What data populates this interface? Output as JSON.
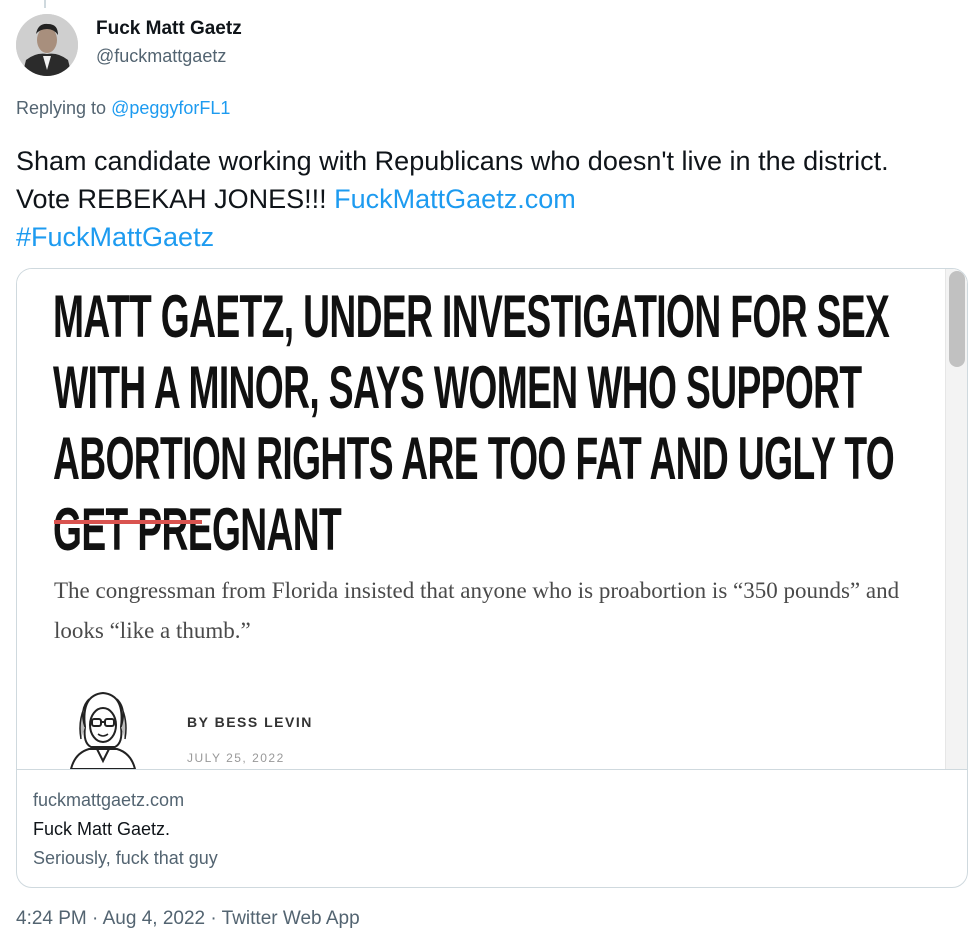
{
  "author": {
    "display_name": "Fuck Matt Gaetz",
    "handle": "@fuckmattgaetz"
  },
  "reply": {
    "prefix": "Replying to",
    "target": "@peggyforFL1"
  },
  "tweet": {
    "text_main": "Sham candidate working with Republicans who doesn't live in the district. Vote REBEKAH JONES!!!",
    "link": "FuckMattGaetz.com",
    "hashtag": "#FuckMattGaetz"
  },
  "card": {
    "image": {
      "headline": "Matt Gaetz, under investigation for sex with a minor, says women who support abortion rights are too fat and ugly to get pregnant",
      "dek": "The congressman from Florida insisted that anyone who is proabortion is “350 pounds” and looks “like a thumb.”",
      "byline": "BY BESS LEVIN",
      "date": "JULY 25, 2022"
    },
    "domain": "fuckmattgaetz.com",
    "title": "Fuck Matt Gaetz.",
    "description": "Seriously, fuck that guy"
  },
  "meta": {
    "time": "4:24 PM",
    "date": "Aug 4, 2022",
    "source": "Twitter Web App",
    "separator": "·"
  },
  "colors": {
    "link": "#1d9bf0",
    "secondary_text": "#536471",
    "accent_rule": "#d9534f"
  }
}
